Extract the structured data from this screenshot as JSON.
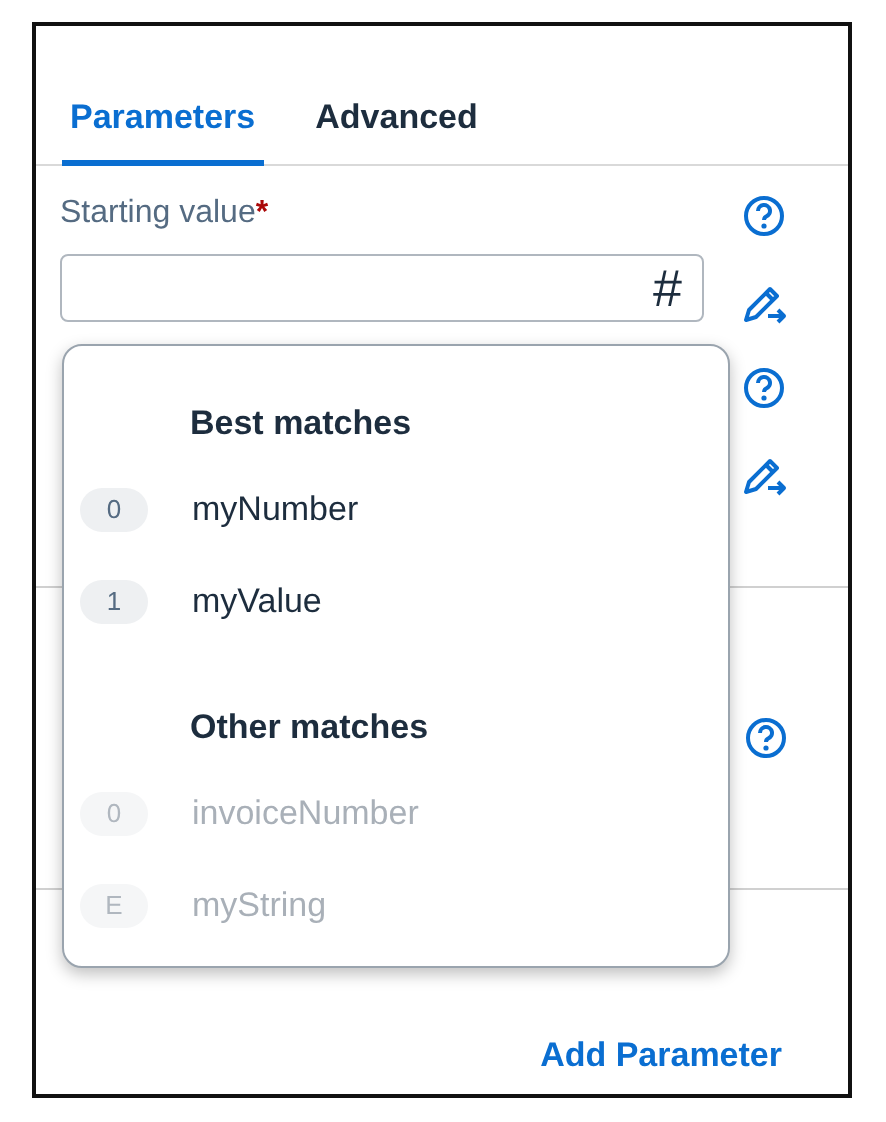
{
  "tabs": [
    {
      "label": "Parameters",
      "selected": true
    },
    {
      "label": "Advanced",
      "selected": false
    }
  ],
  "field": {
    "label": "Starting value",
    "required_mark": "*",
    "type_symbol": "#"
  },
  "dropdown": {
    "groups": [
      {
        "heading": "Best matches",
        "items": [
          {
            "badge": "0",
            "label": "myNumber",
            "disabled": false
          },
          {
            "badge": "1",
            "label": "myValue",
            "disabled": false
          }
        ]
      },
      {
        "heading": "Other matches",
        "items": [
          {
            "badge": "0",
            "label": "invoiceNumber",
            "disabled": true
          },
          {
            "badge": "E",
            "label": "myString",
            "disabled": true
          }
        ]
      }
    ]
  },
  "add_link": "Add Parameter"
}
